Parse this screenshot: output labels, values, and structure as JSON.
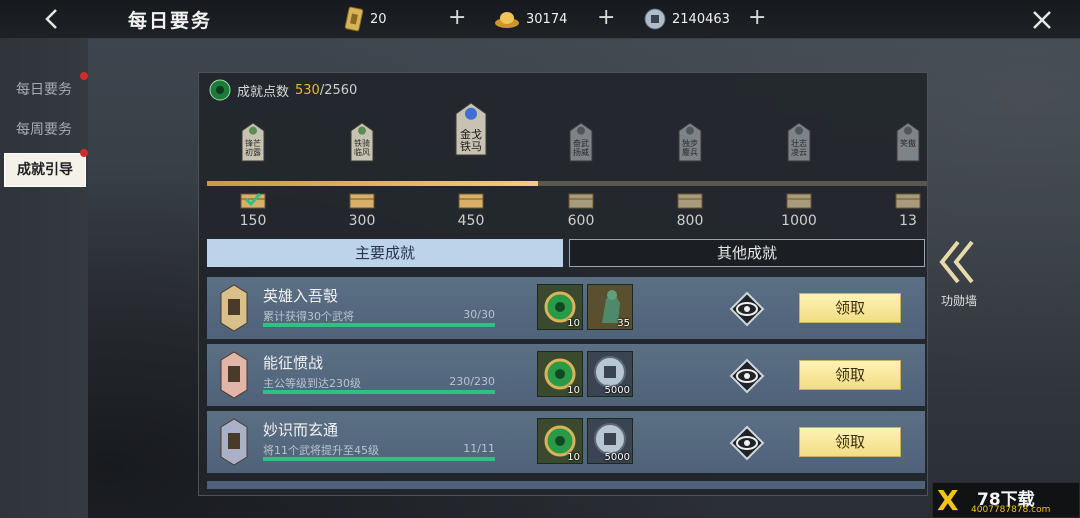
{
  "header": {
    "title": "每日要务",
    "resources": [
      {
        "icon": "token-icon",
        "value": "20"
      },
      {
        "icon": "gold-ingot-icon",
        "value": "30174"
      },
      {
        "icon": "coin-icon",
        "value": "2140463"
      }
    ]
  },
  "sidebar": {
    "items": [
      {
        "label": "每日要务",
        "active": false,
        "dot": true
      },
      {
        "label": "每周要务",
        "active": false,
        "dot": false
      },
      {
        "label": "成就引导",
        "active": true,
        "dot": true
      }
    ]
  },
  "achievement_points": {
    "label": "成就点数",
    "current": "530",
    "total": "/2560"
  },
  "milestones": [
    {
      "tier": "1",
      "name": "锋芒初露",
      "threshold": "150",
      "state": "claimed"
    },
    {
      "tier": "2",
      "name": "铁骑临风",
      "threshold": "300",
      "state": "ready"
    },
    {
      "tier": "3",
      "name": "金戈铁马",
      "threshold": "450",
      "state": "current"
    },
    {
      "tier": "",
      "name": "奋武扬威",
      "threshold": "600",
      "state": "locked"
    },
    {
      "tier": "",
      "name": "独步鏖兵",
      "threshold": "800",
      "state": "locked"
    },
    {
      "tier": "",
      "name": "壮志凌云",
      "threshold": "1000",
      "state": "locked"
    },
    {
      "tier": "",
      "name": "笑傲",
      "threshold": "13",
      "state": "locked"
    }
  ],
  "progress_fraction": 0.46,
  "tabs": {
    "main": "主要成就",
    "other": "其他成就"
  },
  "achievements": [
    {
      "name": "英雄入吾彀",
      "desc": "累计获得30个武将",
      "progress": "30/30",
      "fraction": 1.0,
      "rewards": [
        {
          "icon": "jade-medal-icon",
          "count": "10"
        },
        {
          "icon": "bronze-figure-icon",
          "count": "35"
        }
      ],
      "claim": "领取"
    },
    {
      "name": "能征惯战",
      "desc": "主公等级到达230级",
      "progress": "230/230",
      "fraction": 1.0,
      "rewards": [
        {
          "icon": "jade-medal-icon",
          "count": "10"
        },
        {
          "icon": "coin-icon",
          "count": "5000"
        }
      ],
      "claim": "领取"
    },
    {
      "name": "妙识而玄通",
      "desc": "将11个武将提升至45级",
      "progress": "11/11",
      "fraction": 1.0,
      "rewards": [
        {
          "icon": "jade-medal-icon",
          "count": "10"
        },
        {
          "icon": "coin-icon",
          "count": "5000"
        }
      ],
      "claim": "领取"
    }
  ],
  "merit_wall": {
    "label": "功勋墙"
  },
  "watermark": {
    "mark": "X",
    "name": "78下载",
    "url": "4007787878.com"
  },
  "colors": {
    "accent_gold": "#e2b64c",
    "progress_green": "#2fc083",
    "tab_active": "#bcd3ea",
    "row_bg": "#566a80",
    "claim_bg": "#f2dd84"
  }
}
